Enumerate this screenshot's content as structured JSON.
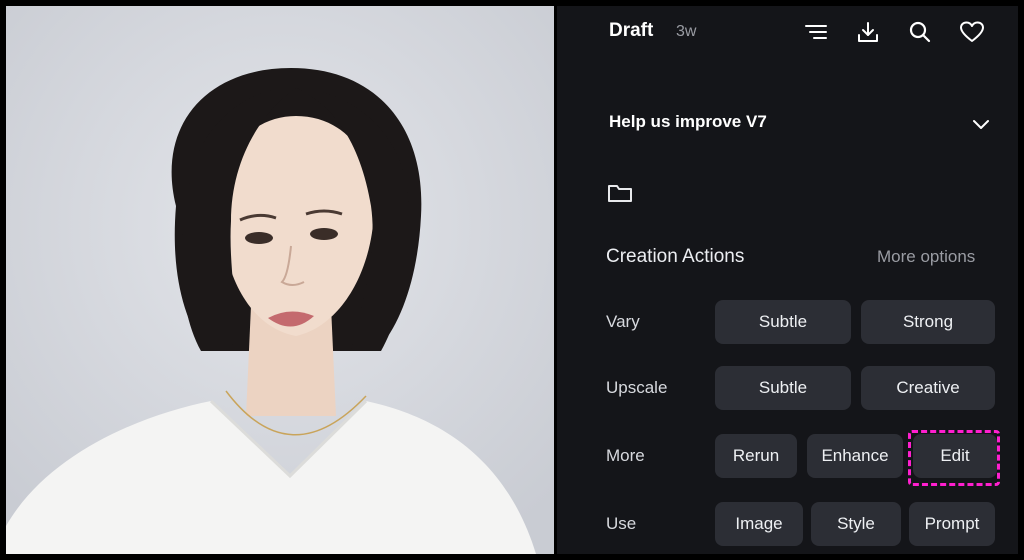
{
  "header": {
    "title": "Draft",
    "age": "3w"
  },
  "feedback": {
    "label": "Help us improve V7"
  },
  "creation_actions": {
    "title": "Creation Actions",
    "more_options": "More options",
    "rows": [
      {
        "label": "Vary",
        "buttons": [
          "Subtle",
          "Strong"
        ]
      },
      {
        "label": "Upscale",
        "buttons": [
          "Subtle",
          "Creative"
        ]
      },
      {
        "label": "More",
        "buttons": [
          "Rerun",
          "Enhance",
          "Edit"
        ]
      },
      {
        "label": "Use",
        "buttons": [
          "Image",
          "Style",
          "Prompt"
        ]
      }
    ]
  },
  "colors": {
    "panel_bg": "#141519",
    "button_bg": "#2c2e35",
    "highlight": "#ff1fcf"
  }
}
